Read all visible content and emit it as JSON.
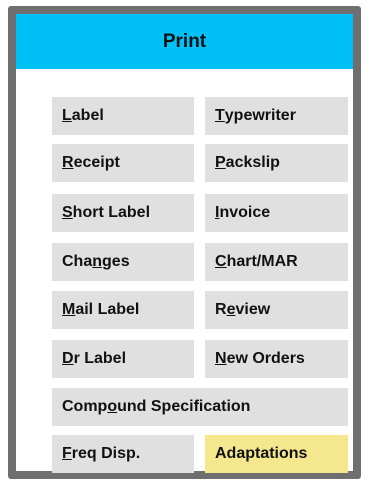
{
  "dialog": {
    "title": "Print"
  },
  "buttons": {
    "label": {
      "pre": "",
      "mnemonic": "L",
      "post": "abel"
    },
    "typewriter": {
      "pre": "",
      "mnemonic": "T",
      "post": "ypewriter"
    },
    "receipt": {
      "pre": "",
      "mnemonic": "R",
      "post": "eceipt"
    },
    "packslip": {
      "pre": "",
      "mnemonic": "P",
      "post": "ackslip"
    },
    "short_label": {
      "pre": "",
      "mnemonic": "S",
      "post": "hort Label"
    },
    "invoice": {
      "pre": "",
      "mnemonic": "I",
      "post": "nvoice"
    },
    "changes": {
      "pre": "Cha",
      "mnemonic": "n",
      "post": "ges"
    },
    "chart_mar": {
      "pre": "",
      "mnemonic": "C",
      "post": "hart/MAR"
    },
    "mail_label": {
      "pre": "",
      "mnemonic": "M",
      "post": "ail Label"
    },
    "review": {
      "pre": "R",
      "mnemonic": "e",
      "post": "view"
    },
    "dr_label": {
      "pre": "",
      "mnemonic": "D",
      "post": "r Label"
    },
    "new_orders": {
      "pre": "",
      "mnemonic": "N",
      "post": "ew Orders"
    },
    "compound_specification": {
      "pre": "Comp",
      "mnemonic": "o",
      "post": "und Specification"
    },
    "freq_disp": {
      "pre": "",
      "mnemonic": "F",
      "post": "req Disp."
    },
    "adaptations": {
      "pre": "",
      "mnemonic": "",
      "post": "Adaptations"
    }
  },
  "colors": {
    "title_bar": "#00c1f7",
    "frame": "#6f6f6f",
    "button": "#e0e0e0",
    "highlight_button": "#f5e78e"
  }
}
